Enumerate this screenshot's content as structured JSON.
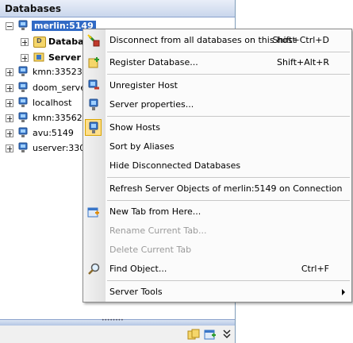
{
  "panel": {
    "title": "Databases"
  },
  "tree": {
    "root": {
      "label": "merlin:5149"
    },
    "children": [
      {
        "label": "Databa"
      },
      {
        "label": "Server"
      }
    ],
    "hosts": [
      {
        "label": "kmn:33523"
      },
      {
        "label": "doom_serve"
      },
      {
        "label": "localhost"
      },
      {
        "label": "kmn:33562"
      },
      {
        "label": "avu:5149"
      },
      {
        "label": "userver:330"
      }
    ]
  },
  "menu": {
    "items": [
      {
        "label": "Disconnect from all databases on this host",
        "shortcut": "Shift+Ctrl+D",
        "icon": "disconnect-icon",
        "disabled": false
      },
      {
        "label": "Register Database...",
        "shortcut": "Shift+Alt+R",
        "icon": "register-database-icon",
        "disabled": false
      },
      {
        "label": "Unregister Host",
        "shortcut": "",
        "icon": "unregister-host-icon",
        "disabled": false
      },
      {
        "label": "Server properties...",
        "shortcut": "",
        "icon": "server-properties-icon",
        "disabled": false
      },
      {
        "label": "Show Hosts",
        "shortcut": "",
        "icon": "show-hosts-icon",
        "disabled": false,
        "checked": true
      },
      {
        "label": "Sort by Aliases",
        "shortcut": "",
        "icon": "",
        "disabled": false
      },
      {
        "label": "Hide Disconnected Databases",
        "shortcut": "",
        "icon": "",
        "disabled": false
      },
      {
        "label": "Refresh Server Objects of merlin:5149 on Connection",
        "shortcut": "",
        "icon": "",
        "disabled": false
      },
      {
        "label": "New Tab from Here...",
        "shortcut": "",
        "icon": "new-tab-icon",
        "disabled": false
      },
      {
        "label": "Rename Current Tab...",
        "shortcut": "",
        "icon": "",
        "disabled": true
      },
      {
        "label": "Delete Current Tab",
        "shortcut": "",
        "icon": "",
        "disabled": true
      },
      {
        "label": "Find Object...",
        "shortcut": "Ctrl+F",
        "icon": "find-icon",
        "disabled": false
      },
      {
        "label": "Server Tools",
        "shortcut": "",
        "icon": "",
        "disabled": false,
        "submenu": true
      }
    ]
  },
  "colors": {
    "selection": "#316ac5",
    "header": "#c9d6ec",
    "checked_highlight": "#ffdf8a"
  }
}
